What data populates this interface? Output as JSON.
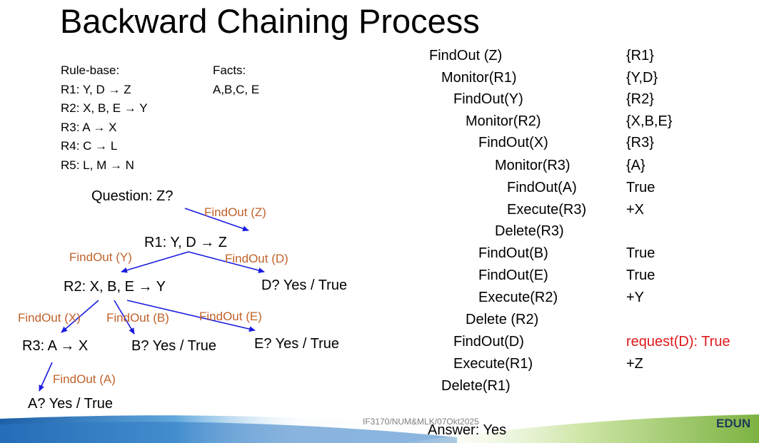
{
  "title": "Backward Chaining Process",
  "rule_base": {
    "heading": "Rule-base:",
    "rules": [
      "R1: Y, D → Z",
      "R2: X, B, E → Y",
      "R3: A → X",
      "R4: C → L",
      "R5: L, M → N"
    ]
  },
  "facts": {
    "heading": "Facts:",
    "values": "A,B,C, E"
  },
  "tree": {
    "question": "Question: Z?",
    "r1": "R1: Y, D → Z",
    "r2": "R2: X, B, E → Y",
    "r3": "R3: A → X",
    "d_answer": "D? Yes / True",
    "b_answer": "B? Yes / True",
    "e_answer": "E? Yes / True",
    "a_answer": "A? Yes / True",
    "edge_labels": {
      "findout_z": "FindOut (Z)",
      "findout_y": "FindOut (Y)",
      "findout_d": "FindOut (D)",
      "findout_x": "FindOut (X)",
      "findout_b": "FindOut (B)",
      "findout_e": "FindOut (E)",
      "findout_a": "FindOut (A)"
    }
  },
  "trace": [
    {
      "step": "FindOut (Z)",
      "result": "{R1}"
    },
    {
      "step": "Monitor(R1)",
      "result": "{Y,D}"
    },
    {
      "step": "FindOut(Y)",
      "result": "{R2}"
    },
    {
      "step": "Monitor(R2)",
      "result": "{X,B,E}"
    },
    {
      "step": "FindOut(X)",
      "result": "{R3}"
    },
    {
      "step": "Monitor(R3)",
      "result": "{A}"
    },
    {
      "step": "FindOut(A)",
      "result": "True"
    },
    {
      "step": "Execute(R3)",
      "result": "+X"
    },
    {
      "step": "Delete(R3)",
      "result": ""
    },
    {
      "step": "FindOut(B)",
      "result": "True"
    },
    {
      "step": "FindOut(E)",
      "result": "True"
    },
    {
      "step": "Execute(R2)",
      "result": "+Y"
    },
    {
      "step": "Delete (R2)",
      "result": ""
    },
    {
      "step": "FindOut(D)",
      "result": "request(D): True"
    },
    {
      "step": "Execute(R1)",
      "result": "+Z"
    },
    {
      "step": "Delete(R1)",
      "result": ""
    }
  ],
  "answer": "Answer: Yes",
  "footer": "IF3170/NUM&MLK/07Okt2025",
  "logo_text": "EDUN",
  "colors": {
    "edge": "#1a1adf",
    "label": "#c0622b",
    "highlight": "#e0181b"
  }
}
